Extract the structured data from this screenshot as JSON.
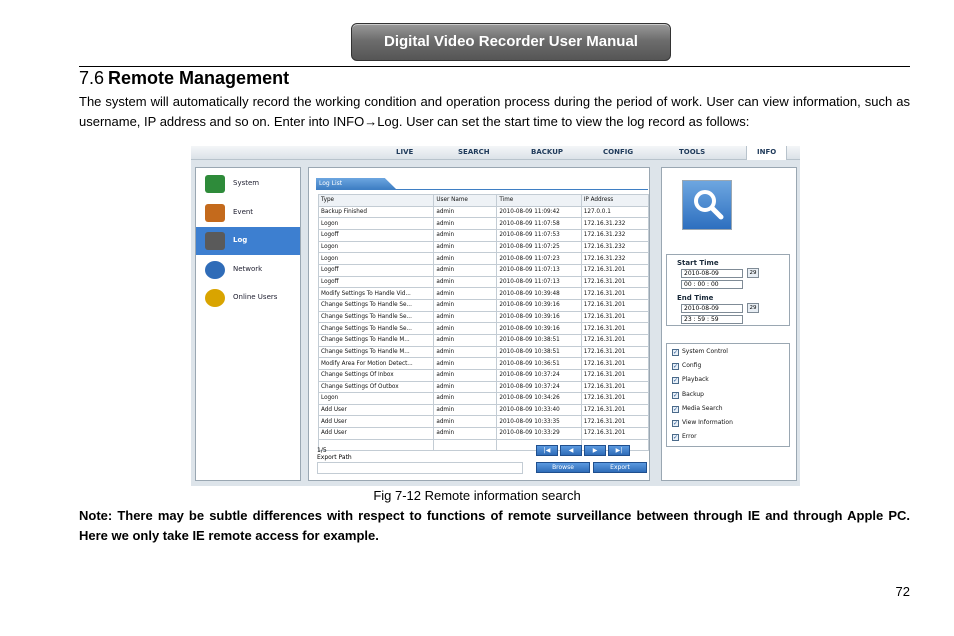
{
  "header": {
    "banner": "Digital Video Recorder User Manual"
  },
  "section": {
    "number": "7.6",
    "title": "Remote Management"
  },
  "intro": "The system will automatically record the working condition and operation process during the period of work. User can view information, such as username, IP address and so on. Enter into INFO→Log. User can set the start time to view the log record as follows:",
  "figure": {
    "caption": "Fig 7-12 Remote information search",
    "nav": [
      "LIVE",
      "SEARCH",
      "BACKUP",
      "CONFIG",
      "TOOLS",
      "INFO"
    ],
    "sidebar": [
      "System",
      "Event",
      "Log",
      "Network",
      "Online Users"
    ],
    "tab_label": "Log List",
    "columns": [
      "Type",
      "User Name",
      "Time",
      "IP Address"
    ],
    "rows": [
      [
        "Backup Finished",
        "admin",
        "2010-08-09 11:09:42",
        "127.0.0.1"
      ],
      [
        "Logon",
        "admin",
        "2010-08-09 11:07:58",
        "172.16.31.232"
      ],
      [
        "Logoff",
        "admin",
        "2010-08-09 11:07:53",
        "172.16.31.232"
      ],
      [
        "Logon",
        "admin",
        "2010-08-09 11:07:25",
        "172.16.31.232"
      ],
      [
        "Logon",
        "admin",
        "2010-08-09 11:07:23",
        "172.16.31.232"
      ],
      [
        "Logoff",
        "admin",
        "2010-08-09 11:07:13",
        "172.16.31.201"
      ],
      [
        "Logoff",
        "admin",
        "2010-08-09 11:07:13",
        "172.16.31.201"
      ],
      [
        "Modify Settings To Handle Vid...",
        "admin",
        "2010-08-09 10:39:48",
        "172.16.31.201"
      ],
      [
        "Change Settings To Handle Se...",
        "admin",
        "2010-08-09 10:39:16",
        "172.16.31.201"
      ],
      [
        "Change Settings To Handle Se...",
        "admin",
        "2010-08-09 10:39:16",
        "172.16.31.201"
      ],
      [
        "Change Settings To Handle Se...",
        "admin",
        "2010-08-09 10:39:16",
        "172.16.31.201"
      ],
      [
        "Change Settings To Handle M...",
        "admin",
        "2010-08-09 10:38:51",
        "172.16.31.201"
      ],
      [
        "Change Settings To Handle M...",
        "admin",
        "2010-08-09 10:38:51",
        "172.16.31.201"
      ],
      [
        "Modify Area For Motion Detect...",
        "admin",
        "2010-08-09 10:36:51",
        "172.16.31.201"
      ],
      [
        "Change Settings Of Inbox",
        "admin",
        "2010-08-09 10:37:24",
        "172.16.31.201"
      ],
      [
        "Change Settings Of Outbox",
        "admin",
        "2010-08-09 10:37:24",
        "172.16.31.201"
      ],
      [
        "Logon",
        "admin",
        "2010-08-09 10:34:26",
        "172.16.31.201"
      ],
      [
        "Add User",
        "admin",
        "2010-08-09 10:33:40",
        "172.16.31.201"
      ],
      [
        "Add User",
        "admin",
        "2010-08-09 10:33:35",
        "172.16.31.201"
      ],
      [
        "Add User",
        "admin",
        "2010-08-09 10:33:29",
        "172.16.31.201"
      ],
      [
        "",
        "",
        "",
        ""
      ]
    ],
    "page_indicator": "1/5",
    "export_label": "Export Path",
    "browse_label": "Browse",
    "export_button": "Export",
    "start_time_label": "Start Time",
    "start_date": "2010-08-09",
    "start_time": "00 : 00 : 00",
    "end_time_label": "End Time",
    "end_date": "2010-08-09",
    "end_time": "23 : 59 : 59",
    "calendar_glyph": "29",
    "filters": [
      "System Control",
      "Config",
      "Playback",
      "Backup",
      "Media Search",
      "View Information",
      "Error"
    ]
  },
  "note": "Note: There may be subtle differences with respect to functions of remote surveillance between through IE and through Apple PC. Here we only take IE remote access for example.",
  "page_number": "72",
  "colors": {
    "accent": "#3d7fd0",
    "banner": "#6d6d6d"
  }
}
